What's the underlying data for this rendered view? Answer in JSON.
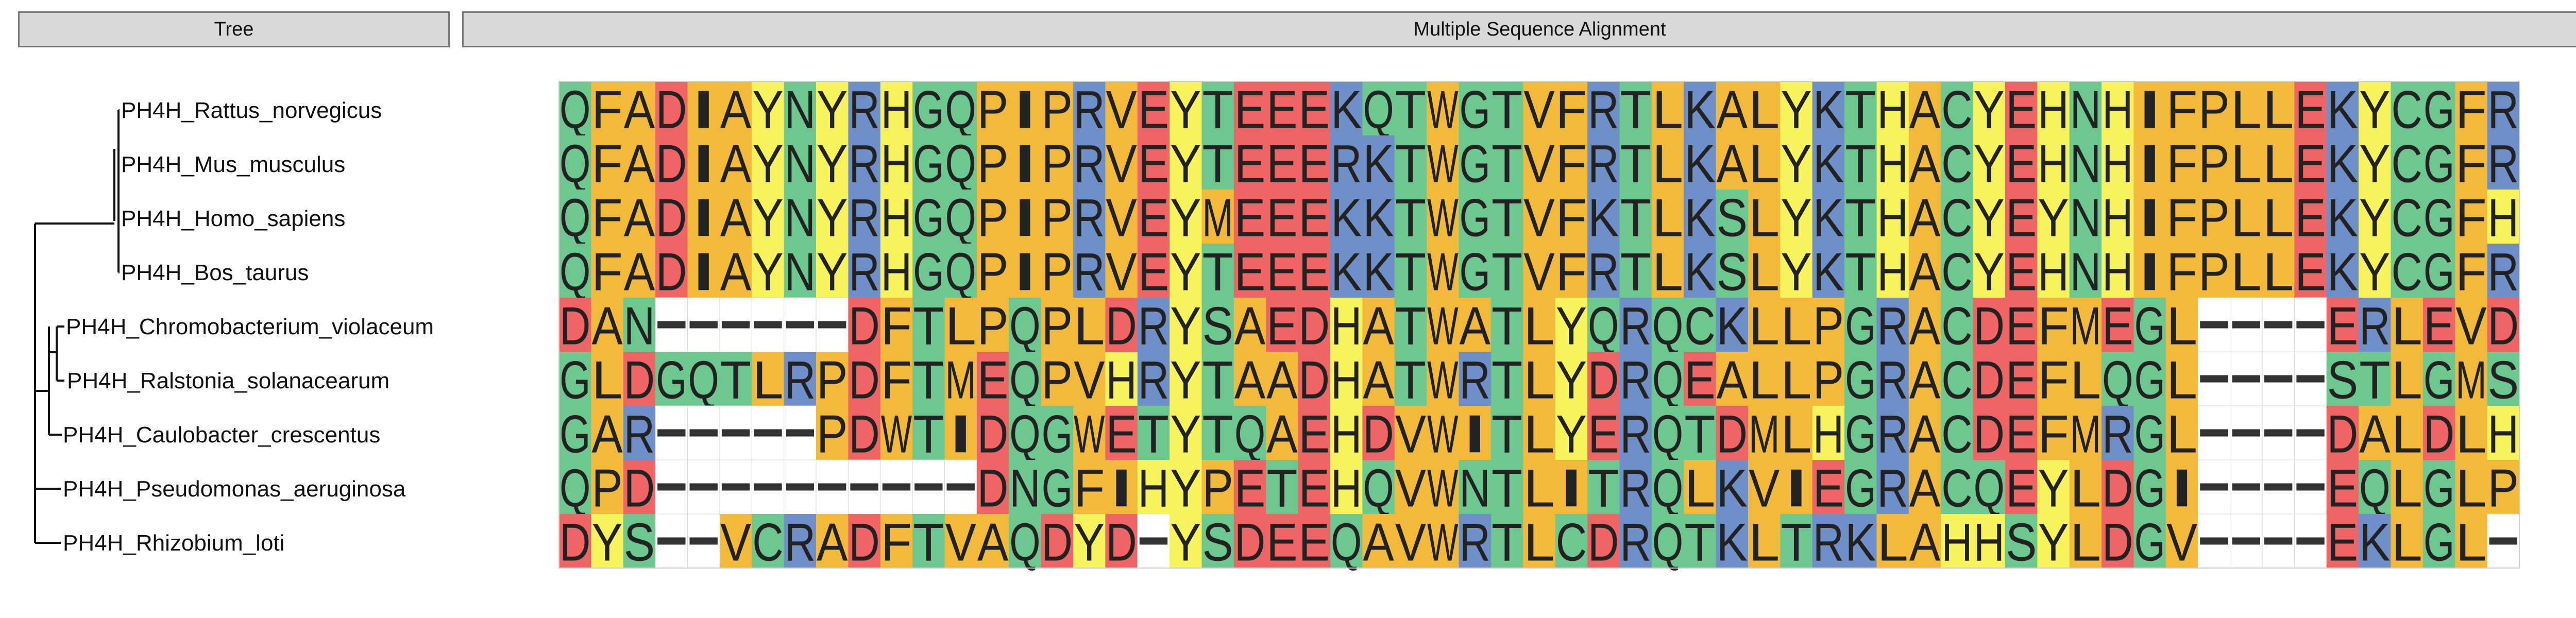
{
  "headers": {
    "tree": "Tree",
    "msa": "Multiple Sequence Alignment"
  },
  "taxa": [
    "PH4H_Rattus_norvegicus",
    "PH4H_Mus_musculus",
    "PH4H_Homo_sapiens",
    "PH4H_Bos_taurus",
    "PH4H_Chromobacterium_violaceum",
    "PH4H_Ralstonia_solanacearum",
    "PH4H_Caulobacter_crescentus",
    "PH4H_Pseudomonas_aeruginosa",
    "PH4H_Rhizobium_loti"
  ],
  "sequences": [
    "QFADIAYNYRHGQPIPRVEYTEEEKQTWGTVFRTLKALYKTHACYEHNHIFPLLEKYCGFR",
    "QFADIAYNYRHGQPIPRVEYTEEERKTWGTVFRTLKALYKTHACYEHNHIFPLLEKYCGFR",
    "QFADIAYNYRHGQPIPRVEYMEEEKKTWGTVFKTLKSLYKTHACYEYNHIFPLLEKYCGFH",
    "QFADIAYNYRHGQPIPRVEYTEEEKKTWGTVFRTLKSLYKTHACYEHNHIFPLLEKYCGFR",
    "DAN------DFTLPQPLDRYSAEDHATWATLYQRQCKLLPGRACDEFMEGL----ERLEVD",
    "GLDGQTLRPDFTMEQPVHRYTAADHATWRTLYDRQEALLPGRACDEFLQGL----STLGMS",
    "GAR-----PDWTIDQGWETYTQAEHDVWITLYERQTDMLHGRACDEFMRGL----DALDLH",
    "QPD----------DNGFIHYPETEHQVWNTLITRQLKVIEGRACQEYLDGI----EQLGLP",
    "DYS--VCRADFTVAQDYD-YSDEEQAVWRTLCDRQTKLTRKLAHHSYLDGV----EKLGL-"
  ],
  "residue_colors": {
    "green": "#6dc88f",
    "orange": "#f2b93a",
    "red": "#ef6464",
    "yellow": "#f7f35c",
    "blue": "#6f8fc9",
    "gap": "#ffffff"
  },
  "residue_groups": {
    "green": "QNSTGC",
    "orange": "FAIPVLMW",
    "red": "DE",
    "yellow": "YH",
    "blue": "RK"
  }
}
